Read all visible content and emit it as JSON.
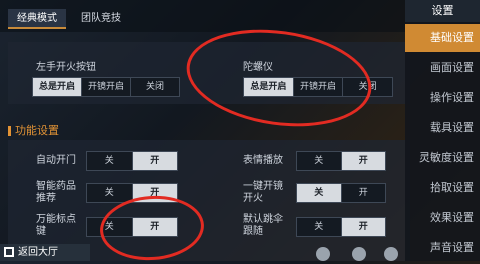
{
  "tabs": [
    {
      "label": "经典模式"
    },
    {
      "label": "团队竞技"
    }
  ],
  "sidebar": {
    "title": "设置",
    "items": [
      {
        "label": "基础设置"
      },
      {
        "label": "画面设置"
      },
      {
        "label": "操作设置"
      },
      {
        "label": "载具设置"
      },
      {
        "label": "灵敏度设置"
      },
      {
        "label": "拾取设置"
      },
      {
        "label": "效果设置"
      },
      {
        "label": "声音设置"
      }
    ]
  },
  "fire": {
    "label": "左手开火按钮",
    "options": [
      "总是开启",
      "开镜开启",
      "关闭"
    ],
    "selected": 0
  },
  "gyro": {
    "label": "陀螺仪",
    "options": [
      "总是开启",
      "开镜开启",
      "关闭"
    ],
    "selected": 0
  },
  "section_title": "功能设置",
  "toggles": [
    {
      "label": "自动开门",
      "off": "关",
      "on": "开",
      "value": "开"
    },
    {
      "label": "智能药品推荐",
      "off": "关",
      "on": "开",
      "value": "开"
    },
    {
      "label": "万能标点键",
      "off": "关",
      "on": "开",
      "value": "开"
    },
    {
      "label": "表情播放",
      "off": "关",
      "on": "开",
      "value": "开"
    },
    {
      "label": "一键开镜开火",
      "off": "关",
      "on": "开",
      "value": "关"
    },
    {
      "label": "默认跳伞跟随",
      "off": "关",
      "on": "开",
      "value": "开"
    }
  ],
  "back_label": "返回大厅"
}
